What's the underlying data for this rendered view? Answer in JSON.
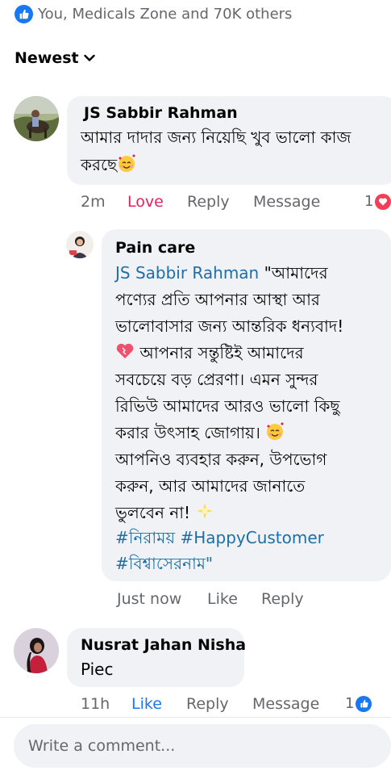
{
  "reactions": {
    "summary": "You, Medicals Zone and 70K others",
    "icon": "like-icon"
  },
  "sort": {
    "label": "Newest",
    "icon": "chevron-down-icon"
  },
  "comments": [
    {
      "author": "JS Sabbir Rahman",
      "lines": [
        "আমার দাদার জন্য নিয়েছি খুব ভালো কাজ",
        "করছে"
      ],
      "time": "2m",
      "reaction_label": "Love",
      "reply_label": "Reply",
      "message_label": "Message",
      "reaction_count": "1",
      "reaction_icon": "love-icon",
      "reply": {
        "author": "Pain care",
        "mention": "JS Sabbir Rahman",
        "line1_rest": " \"আমাদের",
        "lines": [
          "পণ্যের প্রতি আপনার আস্থা আর",
          "ভালোবাসার জন্য আন্তরিক ধন্যবাদ!",
          "আপনার সন্তুষ্টিই আমাদের",
          "সবচেয়ে বড় প্রেরণা। এমন সুন্দর",
          "রিভিউ আমাদের আরও ভালো কিছু",
          "করার উৎসাহ জোগায়।",
          "আপনিও ব্যবহার করুন, উপভোগ",
          "করুন, আর আমাদের জানাতে",
          "ভুলবেন না!"
        ],
        "hashtags_line": "#নিরাময় #HappyCustomer",
        "last_line": "#বিশ্বাসেরনাম\"",
        "time": "Just now",
        "like_label": "Like",
        "reply_label": "Reply"
      }
    },
    {
      "author": "Nusrat Jahan Nisha",
      "lines": [
        "Piec"
      ],
      "time": "11h",
      "reaction_label": "Like",
      "reply_label": "Reply",
      "message_label": "Message",
      "reaction_count": "1",
      "reaction_icon": "like-icon"
    }
  ],
  "composer": {
    "placeholder": "Write a comment..."
  },
  "colors": {
    "brand_blue": "#1877f2",
    "love_red": "#e0245e",
    "link_blue": "#1d6fa5",
    "muted": "#65676b",
    "bubble": "#f0f2f5"
  }
}
